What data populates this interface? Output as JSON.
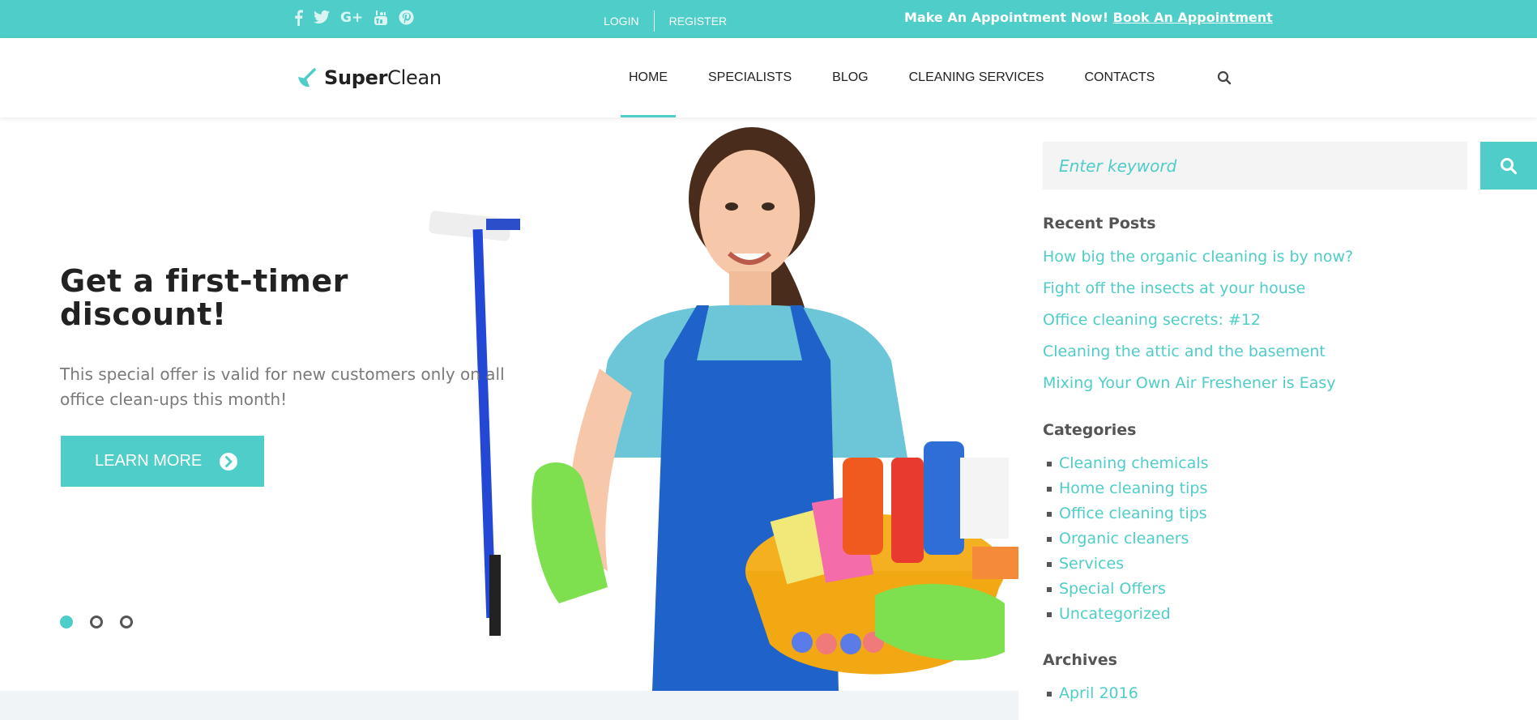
{
  "topbar": {
    "social": [
      {
        "icon": "facebook-icon",
        "glyph": "f"
      },
      {
        "icon": "twitter-icon",
        "glyph": "🐦"
      },
      {
        "icon": "google-plus-icon",
        "glyph": "G+"
      },
      {
        "icon": "youtube-icon",
        "glyph": "▶"
      },
      {
        "icon": "pinterest-icon",
        "glyph": "P"
      }
    ],
    "login": "LOGIN",
    "register": "REGISTER",
    "appointment_text": "Make An Appointment Now!",
    "appointment_link": "Book An Appointment"
  },
  "header": {
    "logo_bold": "Super",
    "logo_light": "Clean",
    "nav": [
      "HOME",
      "SPECIALISTS",
      "BLOG",
      "CLEANING SERVICES",
      "CONTACTS"
    ],
    "active_nav": "HOME"
  },
  "hero": {
    "title": "Get a first-timer discount!",
    "text": "This special offer is valid for new customers only on all office clean-ups this month!",
    "button": "LEARN MORE",
    "slides": 3,
    "active_slide": 1
  },
  "sidebar": {
    "search_placeholder": "Enter keyword",
    "recent_title": "Recent Posts",
    "recent_posts": [
      "How big the organic cleaning is by now?",
      "Fight off the insects at your house",
      "Office cleaning secrets: #12",
      "Cleaning the attic and the basement",
      "Mixing Your Own Air Freshener is Easy"
    ],
    "categories_title": "Categories",
    "categories": [
      "Cleaning chemicals",
      "Home cleaning tips",
      "Office cleaning tips",
      "Organic cleaners",
      "Services",
      "Special Offers",
      "Uncategorized"
    ],
    "archives_title": "Archives",
    "archives": [
      "April 2016"
    ]
  },
  "colors": {
    "accent": "#4fcdc8",
    "text_dark": "#222222",
    "text_muted": "#7a7a7a"
  }
}
